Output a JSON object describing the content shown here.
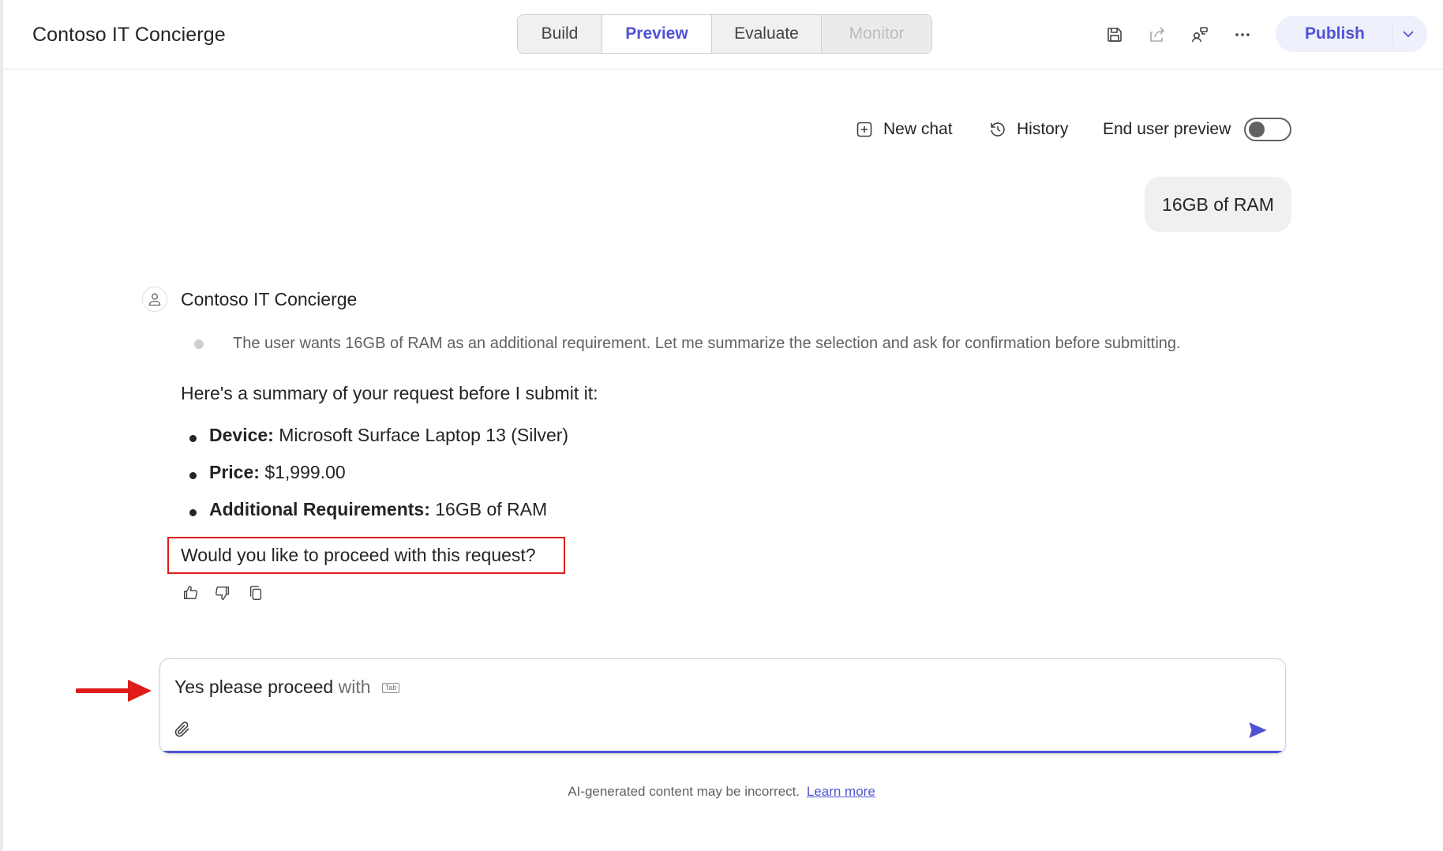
{
  "header": {
    "app_title": "Contoso IT Concierge",
    "tabs": [
      {
        "label": "Build",
        "state": "normal"
      },
      {
        "label": "Preview",
        "state": "selected"
      },
      {
        "label": "Evaluate",
        "state": "normal"
      },
      {
        "label": "Monitor",
        "state": "disabled"
      }
    ],
    "icons": [
      "save-icon",
      "share-icon",
      "connections-icon",
      "more-icon"
    ],
    "publish_label": "Publish"
  },
  "chat_toolbar": {
    "new_chat_label": "New chat",
    "history_label": "History",
    "end_user_preview_label": "End user preview",
    "end_user_preview_on": false
  },
  "conversation": {
    "user_message": "16GB of RAM",
    "bot_name": "Contoso IT Concierge",
    "reasoning": "The user wants 16GB of RAM as an additional requirement. Let me summarize the selection and ask for confirmation before submitting.",
    "summary_intro": "Here's a summary of your request before I submit it:",
    "items": [
      {
        "label": "Device:",
        "value": "Microsoft Surface Laptop 13 (Silver)"
      },
      {
        "label": "Price:",
        "value": "$1,999.00"
      },
      {
        "label": "Additional Requirements:",
        "value": "16GB of RAM"
      }
    ],
    "question": "Would you like to proceed with this request?"
  },
  "composer": {
    "typed_text": "Yes please proceed",
    "suggestion_text": "with",
    "tab_hint": "Tab"
  },
  "footer": {
    "disclaimer": "AI-generated content may be incorrect.",
    "learn_more": "Learn more"
  },
  "colors": {
    "accent": "#4f52d6",
    "annotation_red": "#e01b1b"
  }
}
